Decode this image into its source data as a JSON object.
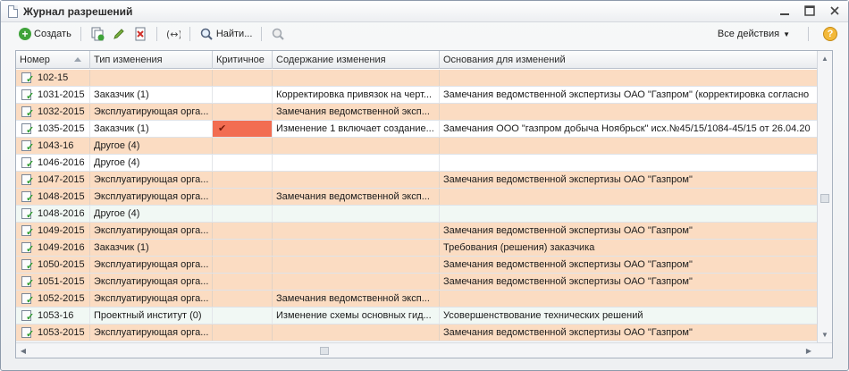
{
  "window": {
    "title": "Журнал разрешений",
    "controls": [
      "minus-icon",
      "maximize-icon",
      "close-icon"
    ]
  },
  "toolbar": {
    "create_label": "Создать",
    "find_label": "Найти...",
    "all_actions_label": "Все действия",
    "help_label": "?"
  },
  "table": {
    "columns": [
      "Номер",
      "Тип изменения",
      "Критичное",
      "Содержание изменения",
      "Основания для изменений"
    ],
    "rows": [
      {
        "num": "102-15",
        "type": "",
        "critical": "",
        "content": "",
        "reason": "",
        "style": "orange"
      },
      {
        "num": "1031-2015",
        "type": "Заказчик (1)",
        "critical": "",
        "content": "Корректировка привязок на черт...",
        "reason": "Замечания ведомственной экспертизы ОАО \"Газпром\" (корректировка согласно",
        "style": "white"
      },
      {
        "num": "1032-2015",
        "type": "Эксплуатирующая орга...",
        "critical": "",
        "content": "Замечания ведомственной эксп...",
        "reason": "",
        "style": "orange"
      },
      {
        "num": "1035-2015",
        "type": "Заказчик (1)",
        "critical": "✔",
        "content": "Изменение 1 включает создание...",
        "reason": "Замечания ООО \"газпром добыча Ноябрьск\" исх.№45/15/1084-45/15 от 26.04.20",
        "style": "white",
        "critical_red": true
      },
      {
        "num": "1043-16",
        "type": "Другое (4)",
        "critical": "",
        "content": "",
        "reason": "",
        "style": "orange"
      },
      {
        "num": "1046-2016",
        "type": "Другое (4)",
        "critical": "",
        "content": "",
        "reason": "",
        "style": "white"
      },
      {
        "num": "1047-2015",
        "type": "Эксплуатирующая орга...",
        "critical": "",
        "content": "",
        "reason": "Замечания ведомственной экспертизы ОАО \"Газпром\"",
        "style": "orange"
      },
      {
        "num": "1048-2015",
        "type": "Эксплуатирующая орга...",
        "critical": "",
        "content": "Замечания ведомственной эксп...",
        "reason": "",
        "style": "orange"
      },
      {
        "num": "1048-2016",
        "type": "Другое (4)",
        "critical": "",
        "content": "",
        "reason": "",
        "style": "lightgreen"
      },
      {
        "num": "1049-2015",
        "type": "Эксплуатирующая орга...",
        "critical": "",
        "content": "",
        "reason": "Замечания ведомственной экспертизы ОАО \"Газпром\"",
        "style": "orange"
      },
      {
        "num": "1049-2016",
        "type": "Заказчик (1)",
        "critical": "",
        "content": "",
        "reason": "Требования (решения) заказчика",
        "style": "orange"
      },
      {
        "num": "1050-2015",
        "type": "Эксплуатирующая орга...",
        "critical": "",
        "content": "",
        "reason": "Замечания ведомственной экспертизы ОАО \"Газпром\"",
        "style": "orange"
      },
      {
        "num": "1051-2015",
        "type": "Эксплуатирующая орга...",
        "critical": "",
        "content": "",
        "reason": "Замечания ведомственной экспертизы ОАО \"Газпром\"",
        "style": "orange"
      },
      {
        "num": "1052-2015",
        "type": "Эксплуатирующая орга...",
        "critical": "",
        "content": "Замечания ведомственной эксп...",
        "reason": "",
        "style": "orange"
      },
      {
        "num": "1053-16",
        "type": "Проектный институт (0)",
        "critical": "",
        "content": "Изменение схемы основных гид...",
        "reason": "Усовершенствование технических решений",
        "style": "lightgreen"
      },
      {
        "num": "1053-2015",
        "type": "Эксплуатирующая орга...",
        "critical": "",
        "content": "",
        "reason": "Замечания ведомственной экспертизы ОАО \"Газпром\"",
        "style": "orange"
      }
    ]
  },
  "colors": {
    "row_orange": "#fbdcc2",
    "row_white": "#ffffff",
    "row_lightgreen": "#f1f8f4",
    "critical_red": "#f26d52"
  }
}
